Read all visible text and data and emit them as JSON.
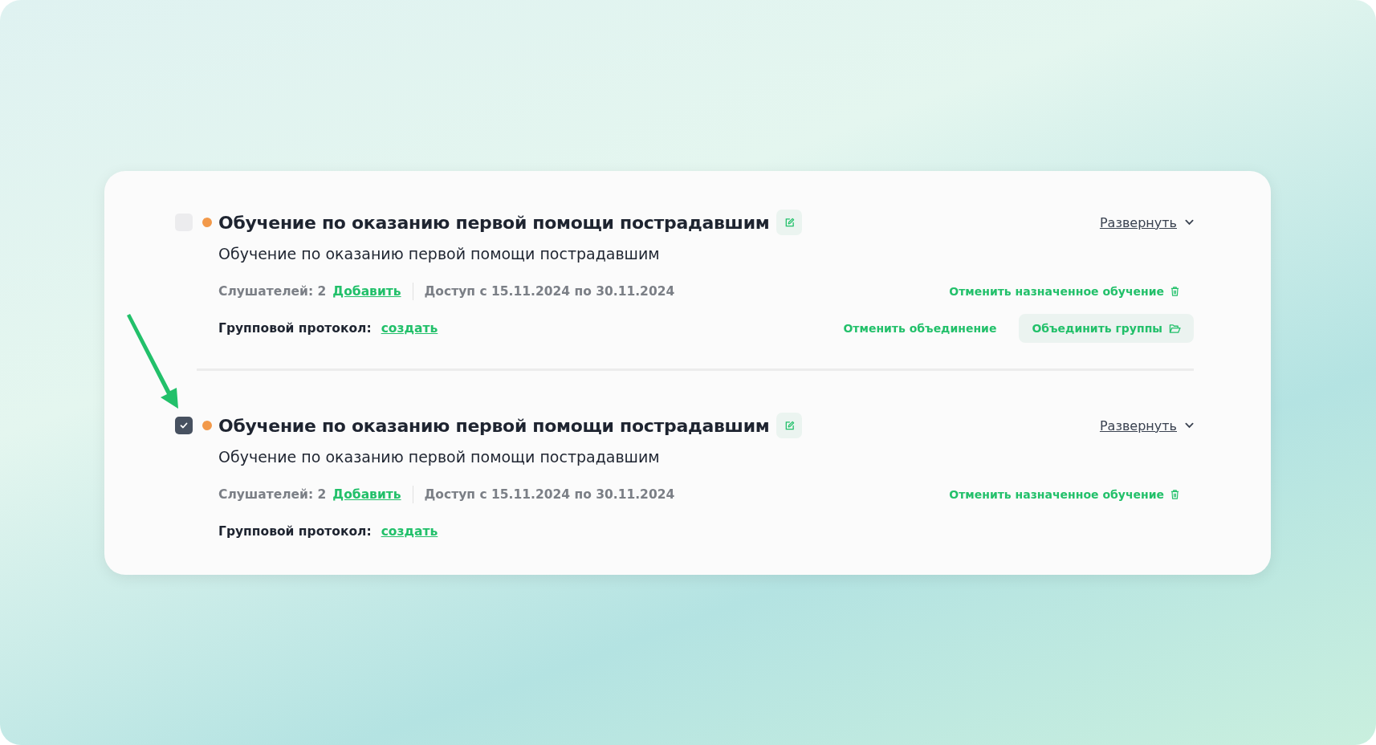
{
  "groups": [
    {
      "checked": false,
      "title": "Обучение по оказанию первой помощи пострадавшим",
      "subtitle": "Обучение по оказанию первой помощи пострадавшим",
      "listeners": "Слушателей: 2",
      "add_link": "Добавить",
      "access": "Доступ с 15.11.2024 по 30.11.2024",
      "expand_link": "Развернуть",
      "cancel_link": "Отменить назначенное обучение",
      "protocol_label": "Групповой протокол:",
      "protocol_link": "создать",
      "merge_actions": {
        "cancel_merge": "Отменить объединение",
        "merge_button": "Объединить группы"
      }
    },
    {
      "checked": true,
      "title": "Обучение по оказанию первой помощи пострадавшим",
      "subtitle": "Обучение по оказанию первой помощи пострадавшим",
      "listeners": "Слушателей: 2",
      "add_link": "Добавить",
      "access": "Доступ с 15.11.2024 по 30.11.2024",
      "expand_link": "Развернуть",
      "cancel_link": "Отменить назначенное обучение",
      "protocol_label": "Групповой протокол:",
      "protocol_link": "создать"
    }
  ]
}
